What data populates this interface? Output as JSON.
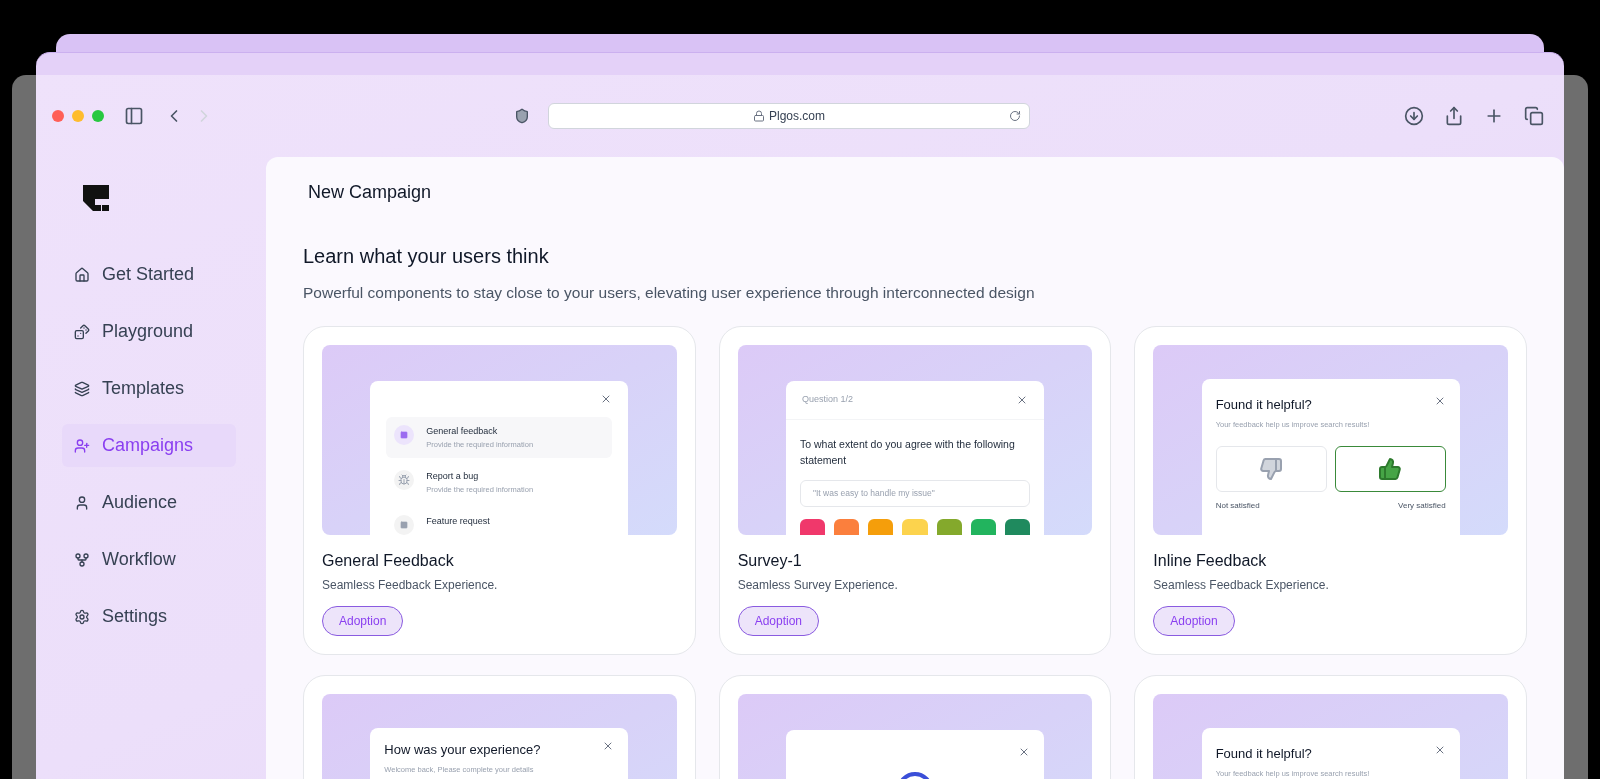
{
  "browser": {
    "url": "Plgos.com"
  },
  "sidebar": {
    "items": [
      {
        "label": "Get Started",
        "selected": false,
        "kind": "home"
      },
      {
        "label": "Playground",
        "selected": false,
        "kind": "dice"
      },
      {
        "label": "Templates",
        "selected": false,
        "kind": "layers"
      },
      {
        "label": "Campaigns",
        "selected": true,
        "kind": "user-plus"
      },
      {
        "label": "Audience",
        "selected": false,
        "kind": "user"
      },
      {
        "label": "Workflow",
        "selected": false,
        "kind": "fork"
      },
      {
        "label": "Settings",
        "selected": false,
        "kind": "gear"
      }
    ]
  },
  "page": {
    "title": "New Campaign",
    "heading": "Learn what your users think",
    "subheading": "Powerful components to stay close to your users, elevating user experience through interconnected design"
  },
  "cards": [
    {
      "title": "General Feedback",
      "description": "Seamless Feedback Experience.",
      "tag": "Adoption",
      "preview": {
        "kind": "options",
        "options": [
          {
            "title": "General feedback",
            "subtitle": "Provide the required information",
            "selected": true
          },
          {
            "title": "Report a bug",
            "subtitle": "Provide the required information",
            "selected": false
          },
          {
            "title": "Feature request",
            "selected": false
          }
        ]
      }
    },
    {
      "title": "Survey-1",
      "description": "Seamless Survey Experience.",
      "tag": "Adoption",
      "preview": {
        "kind": "survey",
        "header": "Question 1/2",
        "question": "To what extent do you agree with the following statement",
        "statement": "\"It was easy to handle my issue\"",
        "scale": [
          {
            "color": "#f0386b"
          },
          {
            "color": "#fb7f3d"
          },
          {
            "color": "#f59e0b"
          },
          {
            "color": "#fcd34d"
          },
          {
            "color": "#84a92c"
          },
          {
            "color": "#22b45e"
          },
          {
            "color": "#1f8a5e"
          }
        ]
      }
    },
    {
      "title": "Inline Feedback",
      "description": "Seamless Feedback Experience.",
      "tag": "Adoption",
      "preview": {
        "kind": "thumbs",
        "heading": "Found it helpful?",
        "subtitle": "Your feedback help us improve search results!",
        "left_label": "Not satisfied",
        "right_label": "Very satisfied",
        "up_selected": true
      }
    },
    {
      "preview": {
        "kind": "experience",
        "heading": "How was your experience?",
        "subtitle": "Welcome back, Please complete your details"
      }
    },
    {
      "preview": {
        "kind": "spinner"
      }
    },
    {
      "preview": {
        "kind": "thumbs",
        "heading": "Found it helpful?",
        "subtitle": "Your feedback help us improve search results!"
      }
    }
  ]
}
